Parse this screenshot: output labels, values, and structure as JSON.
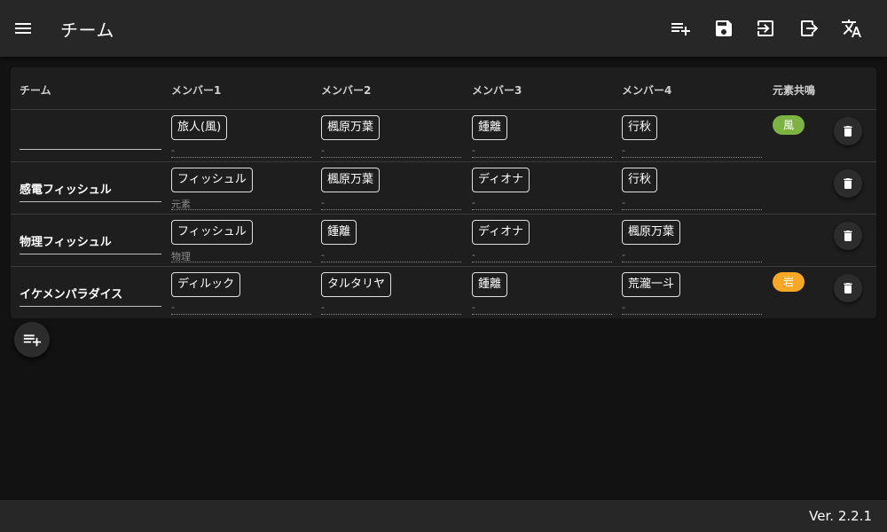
{
  "header": {
    "title": "チーム",
    "icons": [
      "menu-icon",
      "playlist-add-icon",
      "save-icon",
      "import-icon",
      "export-icon",
      "translate-icon"
    ]
  },
  "table": {
    "headers": {
      "team": "チーム",
      "member1": "メンバー1",
      "member2": "メンバー2",
      "member3": "メンバー3",
      "member4": "メンバー4",
      "resonance": "元素共鳴"
    },
    "rows": [
      {
        "team": "",
        "members": [
          {
            "name": "旅人(風)",
            "sub": "-"
          },
          {
            "name": "楓原万葉",
            "sub": "-"
          },
          {
            "name": "鍾離",
            "sub": "-"
          },
          {
            "name": "行秋",
            "sub": "-"
          }
        ],
        "resonance": "風",
        "resonance_color": "#7cb342"
      },
      {
        "team": "感電フィッシュル",
        "members": [
          {
            "name": "フィッシュル",
            "sub": "元素"
          },
          {
            "name": "楓原万葉",
            "sub": "-"
          },
          {
            "name": "ディオナ",
            "sub": "-"
          },
          {
            "name": "行秋",
            "sub": "-"
          }
        ],
        "resonance": "",
        "resonance_color": ""
      },
      {
        "team": "物理フィッシュル",
        "members": [
          {
            "name": "フィッシュル",
            "sub": "物理"
          },
          {
            "name": "鍾離",
            "sub": "-"
          },
          {
            "name": "ディオナ",
            "sub": "-"
          },
          {
            "name": "楓原万葉",
            "sub": "-"
          }
        ],
        "resonance": "",
        "resonance_color": ""
      },
      {
        "team": "イケメンパラダイス",
        "members": [
          {
            "name": "ディルック",
            "sub": "-"
          },
          {
            "name": "タルタリヤ",
            "sub": "-"
          },
          {
            "name": "鍾離",
            "sub": "-"
          },
          {
            "name": "荒瀧一斗",
            "sub": "-"
          }
        ],
        "resonance": "岩",
        "resonance_color": "#f9a825"
      }
    ]
  },
  "footer": {
    "version": "Ver. 2.2.1"
  },
  "colors": {
    "background": "#121212",
    "appbar": "#272727",
    "card": "#1e1e1e"
  }
}
